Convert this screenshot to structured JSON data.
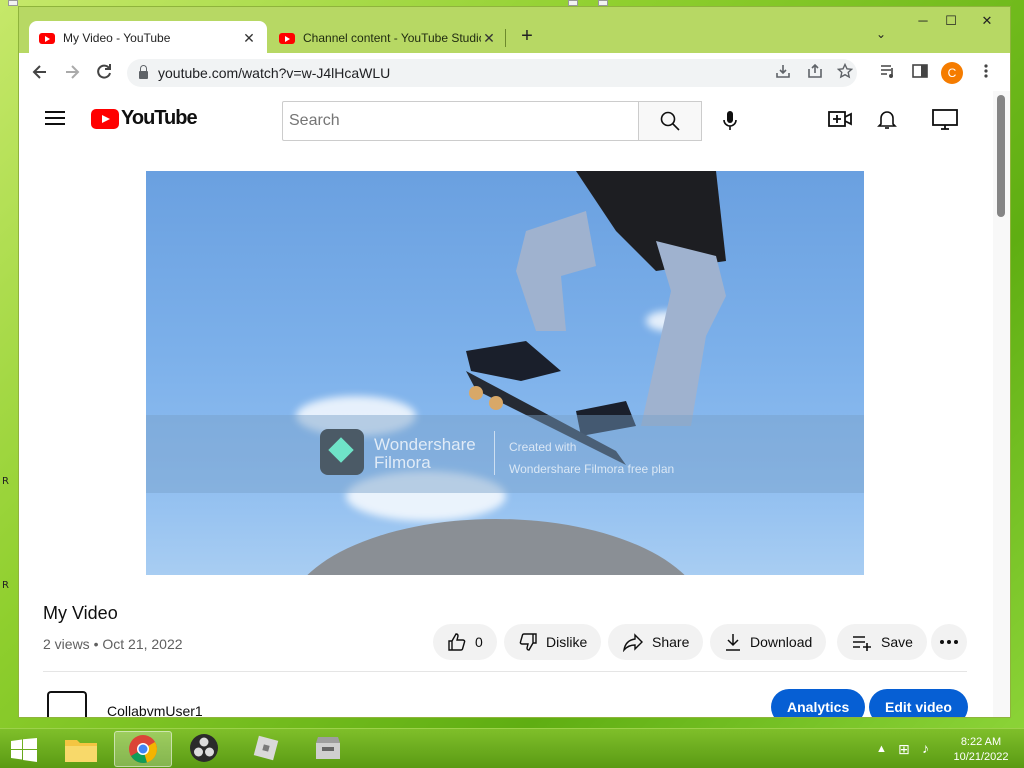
{
  "window": {
    "tabs": [
      {
        "title": "My Video - YouTube",
        "close": "✕"
      },
      {
        "title": "Channel content - YouTube Studio",
        "close": "✕"
      }
    ],
    "new_tab": "+",
    "tab_search": "⌄",
    "controls": {
      "minimize": "─",
      "maximize": "☐",
      "close": "✕"
    }
  },
  "toolbar": {
    "url": "youtube.com/watch?v=w-J4lHcaWLU",
    "profile_initial": "C"
  },
  "youtube": {
    "logo_text": "YouTube",
    "search_placeholder": "Search"
  },
  "video": {
    "watermark_title_1": "Wondershare",
    "watermark_title_2": "Filmora",
    "watermark_sub_1": "Created with",
    "watermark_sub_2": "Wondershare Filmora free plan",
    "title": "My Video",
    "meta": "2 views • Oct 21, 2022"
  },
  "actions": {
    "like_count": "0",
    "dislike": "Dislike",
    "share": "Share",
    "download": "Download",
    "save": "Save"
  },
  "channel": {
    "name": "CollabvmUser1",
    "analytics": "Analytics",
    "edit_video": "Edit video"
  },
  "desktop": {
    "label_1": "R",
    "label_2": "R"
  },
  "taskbar": {
    "time": "8:22 AM",
    "date": "10/21/2022"
  },
  "colors": {
    "accent_blue": "#065fd4",
    "youtube_red": "#ff0000",
    "desktop_green": "#5fae12"
  }
}
